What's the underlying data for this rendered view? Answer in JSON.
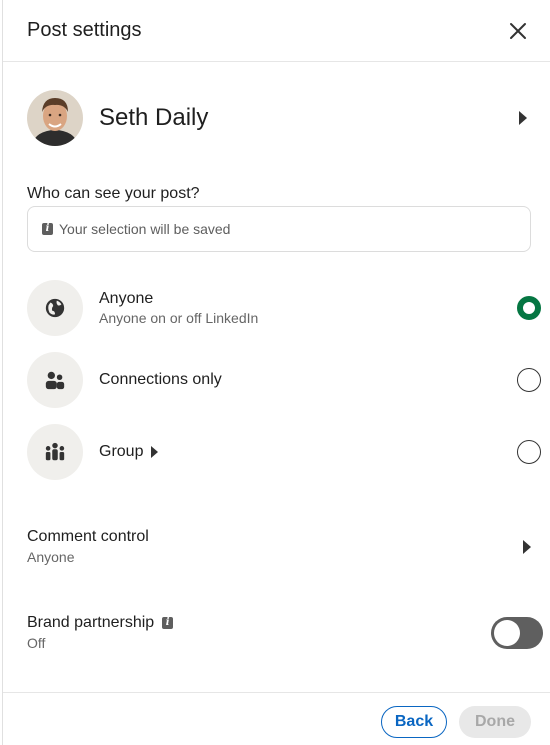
{
  "header": {
    "title": "Post settings"
  },
  "profile": {
    "name": "Seth Daily"
  },
  "visibility": {
    "question": "Who can see your post?",
    "info": "Your selection will be saved",
    "options": [
      {
        "title": "Anyone",
        "subtitle": "Anyone on or off LinkedIn",
        "selected": true,
        "icon": "globe-icon"
      },
      {
        "title": "Connections only",
        "subtitle": "",
        "selected": false,
        "icon": "people-icon"
      },
      {
        "title": "Group",
        "subtitle": "",
        "selected": false,
        "icon": "group-icon"
      }
    ]
  },
  "comment_control": {
    "title": "Comment control",
    "value": "Anyone"
  },
  "brand_partnership": {
    "title": "Brand partnership",
    "value": "Off",
    "enabled": false
  },
  "footer": {
    "back_label": "Back",
    "done_label": "Done"
  },
  "colors": {
    "selected_radio": "#057642",
    "primary": "#0a66c2",
    "toggle_off": "#5f5f5f"
  }
}
